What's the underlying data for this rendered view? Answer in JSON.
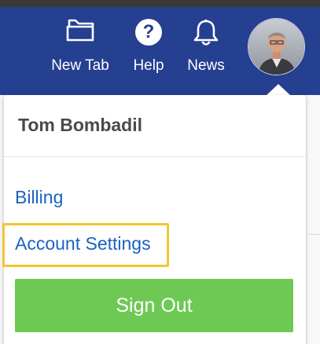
{
  "nav": {
    "new_tab_label": "New Tab",
    "help_label": "Help",
    "news_label": "News"
  },
  "menu": {
    "user_name": "Tom Bombadil",
    "billing_label": "Billing",
    "account_settings_label": "Account Settings",
    "sign_out_label": "Sign Out"
  },
  "icons": {
    "new_tab": "folder-tab-icon",
    "help": "help-circle-icon",
    "news": "bell-icon",
    "avatar": "user-avatar-photo"
  },
  "colors": {
    "header": "#253f91",
    "link": "#1b62c4",
    "highlight": "#f3c630",
    "sign_out_button": "#6ec954"
  }
}
